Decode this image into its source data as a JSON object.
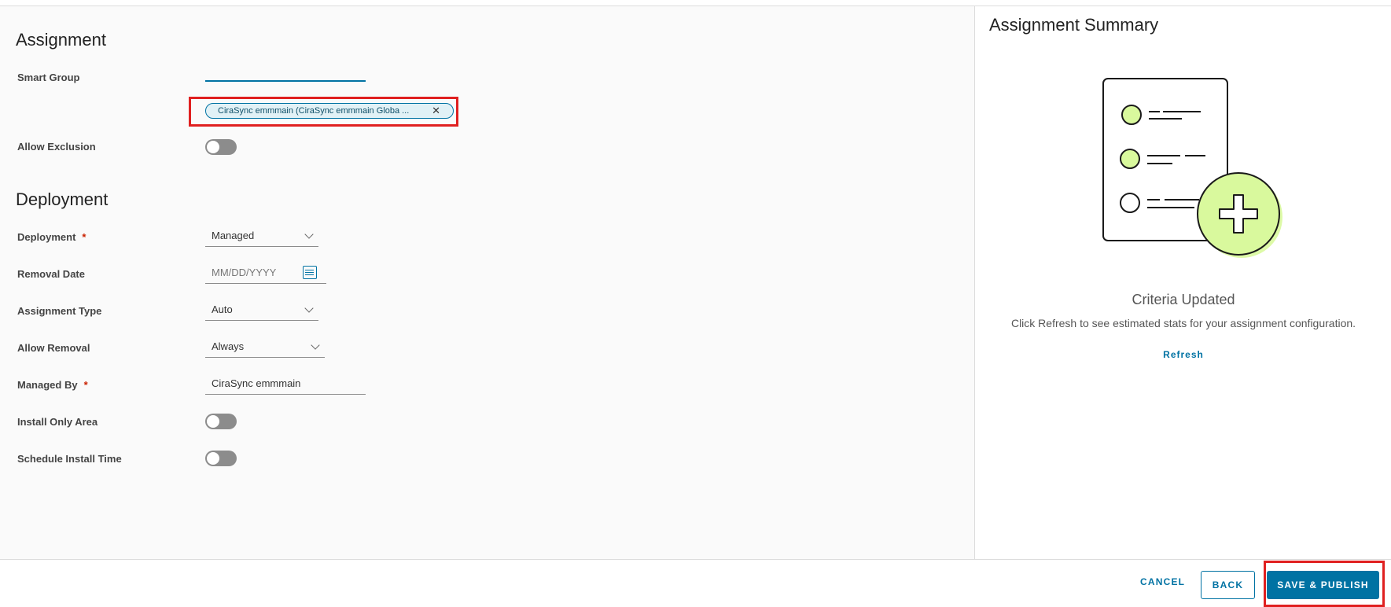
{
  "assignment": {
    "title": "Assignment",
    "smart_group_label": "Smart Group",
    "smart_group_chip": "CiraSync emmmain (CiraSync emmmain Globa ...",
    "allow_exclusion_label": "Allow Exclusion"
  },
  "deployment": {
    "title": "Deployment",
    "required_mark": "*",
    "deployment_label": "Deployment",
    "deployment_value": "Managed",
    "removal_date_label": "Removal Date",
    "removal_date_placeholder": "MM/DD/YYYY",
    "assignment_type_label": "Assignment Type",
    "assignment_type_value": "Auto",
    "allow_removal_label": "Allow Removal",
    "allow_removal_value": "Always",
    "managed_by_label": "Managed By",
    "managed_by_value": "CiraSync emmmain",
    "install_only_area_label": "Install Only Area",
    "schedule_install_time_label": "Schedule Install Time"
  },
  "summary": {
    "title": "Assignment Summary",
    "criteria_title": "Criteria Updated",
    "criteria_desc": "Click Refresh to see estimated stats for your assignment configuration.",
    "refresh_label": "Refresh"
  },
  "footer": {
    "cancel_label": "CANCEL",
    "back_label": "BACK",
    "publish_label": "SAVE & PUBLISH"
  },
  "toggles": {
    "allow_exclusion": false,
    "install_only_area": false,
    "schedule_install_time": false
  },
  "colors": {
    "accent": "#0072a3",
    "highlight": "#e02020",
    "illustration_green": "#d9f99d"
  }
}
